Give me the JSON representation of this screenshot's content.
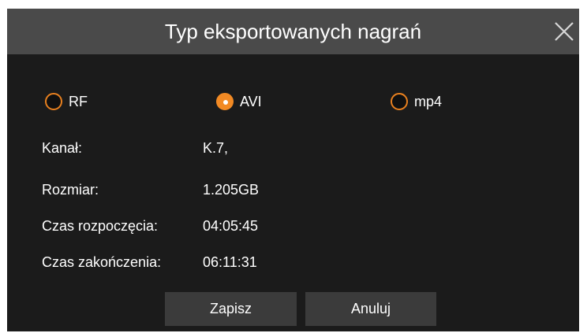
{
  "dialog": {
    "title": "Typ eksportowanych nagrań",
    "close_icon": "close-icon"
  },
  "format_options": [
    {
      "label": "RF",
      "selected": false
    },
    {
      "label": "AVI",
      "selected": true
    },
    {
      "label": "mp4",
      "selected": false
    }
  ],
  "details": {
    "channel_label": "Kanał:",
    "channel_value": "K.7,",
    "size_label": "Rozmiar:",
    "size_value": "1.205GB",
    "start_label": "Czas rozpoczęcia:",
    "start_value": "04:05:45",
    "end_label": "Czas zakończenia:",
    "end_value": "06:11:31"
  },
  "buttons": {
    "save_label": "Zapisz",
    "cancel_label": "Anuluj"
  },
  "colors": {
    "accent": "#f28a24",
    "titlebar": "#4a4a4a",
    "background": "#1b1b1b",
    "button": "#3b3b3b"
  }
}
